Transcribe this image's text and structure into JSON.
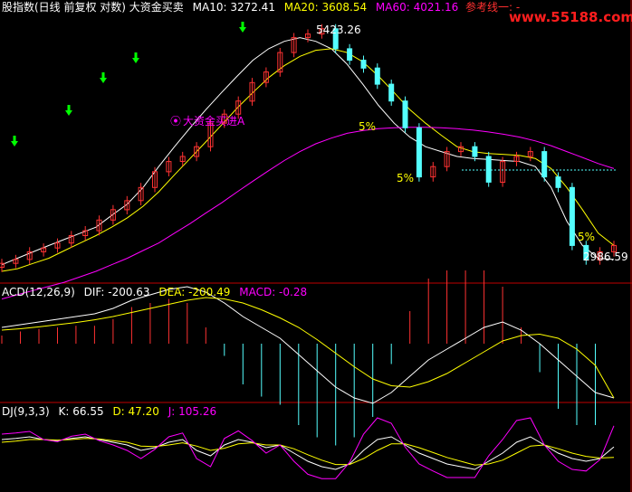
{
  "header": {
    "title": "股指数(日线 前复权 对数) 大资金买卖",
    "ma10": "MA10: 3272.41",
    "ma20": "MA20: 3608.54",
    "ma60": "MA60: 4021.16",
    "ref_label": "参考线一: -",
    "watermark": "www.55188.com"
  },
  "macd_header": {
    "name": "ACD(12,26,9)",
    "dif": "DIF: -200.63",
    "dea": "DEA: -200.49",
    "macd": "MACD: -0.28"
  },
  "kdj_header": {
    "name": "DJ(9,3,3)",
    "k": "K: 66.55",
    "d": "D: 47.20",
    "j": "J: 105.26"
  },
  "annotations": {
    "high": "5423.26",
    "low": "2986.59",
    "buy_signal": "大资金买进A",
    "pct_1": "5%",
    "pct_2": "5%",
    "pct_3": "5%"
  },
  "colors": {
    "up": "#ff3232",
    "down": "#54ffff",
    "yellow": "#ffff00",
    "ma10": "#ffffff",
    "ma20": "#ffff00",
    "ma60": "#ff00ff",
    "panel_border": "#c00000",
    "buy_arrow": "#00ff00"
  },
  "chart_data": [
    {
      "type": "candlestick",
      "panel": "price",
      "ylim": [
        2900,
        5600
      ],
      "series": [
        {
          "name": "MA10",
          "values": [
            2950,
            3000,
            3050,
            3100,
            3150,
            3200,
            3250,
            3350,
            3450,
            3600,
            3800,
            4000,
            4200,
            4400,
            4600,
            4800,
            5000,
            5150,
            5250,
            5300,
            5250,
            5150,
            4950,
            4700,
            4450,
            4250,
            4100,
            4000,
            3950,
            3900,
            3880,
            3870,
            3860,
            3850,
            3800,
            3600,
            3300,
            3100,
            3000,
            2990
          ]
        },
        {
          "name": "MA20",
          "values": [
            2900,
            2920,
            2960,
            3000,
            3060,
            3120,
            3180,
            3250,
            3330,
            3430,
            3560,
            3720,
            3880,
            4050,
            4230,
            4420,
            4600,
            4780,
            4930,
            5050,
            5130,
            5150,
            5100,
            4980,
            4800,
            4600,
            4400,
            4250,
            4120,
            4000,
            3950,
            3930,
            3920,
            3910,
            3880,
            3780,
            3600,
            3400,
            3200,
            3100
          ]
        },
        {
          "name": "MA60",
          "values": [
            2700,
            2730,
            2760,
            2790,
            2820,
            2860,
            2900,
            2950,
            3000,
            3060,
            3120,
            3200,
            3280,
            3370,
            3460,
            3560,
            3660,
            3760,
            3860,
            3950,
            4030,
            4090,
            4140,
            4170,
            4190,
            4200,
            4205,
            4205,
            4200,
            4190,
            4175,
            4155,
            4130,
            4100,
            4060,
            4010,
            3950,
            3890,
            3830,
            3780
          ]
        }
      ],
      "candles_close": [
        2960,
        2990,
        3050,
        3080,
        3120,
        3180,
        3220,
        3310,
        3400,
        3480,
        3600,
        3750,
        3850,
        3900,
        4000,
        4250,
        4350,
        4500,
        4720,
        4850,
        5100,
        5300,
        5350,
        5423,
        5150,
        5000,
        4900,
        4700,
        4500,
        4200,
        3700,
        3800,
        3950,
        4000,
        3900,
        3650,
        3850,
        3900,
        3950,
        3700,
        3600,
        3100,
        2986,
        3050,
        3100
      ]
    },
    {
      "type": "bar",
      "panel": "macd",
      "series": [
        {
          "name": "DIF",
          "values": [
            60,
            70,
            80,
            90,
            100,
            110,
            130,
            160,
            180,
            200,
            210,
            190,
            150,
            100,
            60,
            20,
            -40,
            -100,
            -160,
            -200,
            -220,
            -180,
            -120,
            -60,
            -20,
            20,
            60,
            80,
            50,
            0,
            -60,
            -120,
            -180,
            -200
          ]
        },
        {
          "name": "DEA",
          "values": [
            50,
            55,
            62,
            70,
            78,
            88,
            100,
            115,
            130,
            145,
            160,
            170,
            165,
            150,
            125,
            95,
            60,
            15,
            -35,
            -85,
            -130,
            -155,
            -160,
            -140,
            -110,
            -70,
            -30,
            10,
            30,
            35,
            20,
            -20,
            -80,
            -200
          ]
        }
      ]
    },
    {
      "type": "line",
      "panel": "kdj",
      "series": [
        {
          "name": "K",
          "values": [
            80,
            82,
            85,
            80,
            78,
            82,
            85,
            80,
            75,
            70,
            60,
            65,
            75,
            80,
            60,
            50,
            70,
            80,
            75,
            65,
            70,
            55,
            40,
            30,
            25,
            35,
            60,
            80,
            85,
            70,
            55,
            45,
            35,
            30,
            25,
            40,
            55,
            75,
            85,
            70,
            55,
            45,
            40,
            45,
            66.55
          ]
        },
        {
          "name": "D",
          "values": [
            75,
            77,
            80,
            80,
            79,
            80,
            82,
            81,
            78,
            75,
            68,
            67,
            70,
            74,
            68,
            60,
            64,
            72,
            74,
            70,
            70,
            63,
            52,
            42,
            34,
            34,
            45,
            60,
            72,
            72,
            65,
            56,
            47,
            40,
            33,
            35,
            42,
            55,
            68,
            70,
            63,
            55,
            49,
            46,
            47.2
          ]
        },
        {
          "name": "J",
          "values": [
            90,
            92,
            95,
            80,
            76,
            86,
            90,
            78,
            70,
            60,
            45,
            62,
            85,
            92,
            45,
            30,
            82,
            96,
            78,
            55,
            70,
            40,
            16,
            8,
            8,
            38,
            90,
            120,
            110,
            66,
            35,
            22,
            10,
            10,
            10,
            50,
            80,
            115,
            120,
            70,
            40,
            25,
            22,
            43,
            105.26
          ]
        }
      ]
    }
  ]
}
